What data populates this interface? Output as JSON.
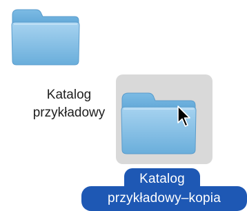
{
  "desktop": {
    "items": [
      {
        "icon": "folder-icon",
        "label_lines": [
          "Katalog",
          "przykładowy"
        ],
        "selected": false
      },
      {
        "icon": "folder-icon",
        "label_lines": [
          "Katalog",
          "przykładowy–kopia"
        ],
        "selected": true
      }
    ]
  },
  "colors": {
    "folder_body": "#8ec6ea",
    "folder_tab": "#6fb1de",
    "selection_box": "#d9d9d9",
    "selection_label": "#1e58b4",
    "label_text": "#1e1e1e"
  },
  "cursor": {
    "icon": "arrow-cursor-icon"
  }
}
